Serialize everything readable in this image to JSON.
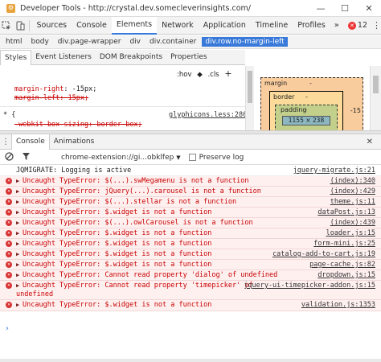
{
  "window": {
    "title": "Developer Tools - http://crystal.dev.somecleverinsights.com/",
    "minimize_glyph": "—",
    "maximize_glyph": "☐",
    "close_glyph": "✕"
  },
  "tabs": {
    "items": [
      "Sources",
      "Console",
      "Elements",
      "Network",
      "Application",
      "Timeline",
      "Profiles"
    ],
    "active": "Elements",
    "more_label": "»",
    "error_count": "12",
    "error_badge_glyph": "✕",
    "kebab_glyph": "⋮"
  },
  "breadcrumbs": [
    "html",
    "body",
    "div.page-wrapper",
    "div",
    "div.container",
    "div.row.no-margin-left"
  ],
  "styles_tabs": [
    "Styles",
    "Event Listeners",
    "DOM Breakpoints",
    "Properties"
  ],
  "styles": {
    "hov_label": ":hov",
    "cls_label": ".cls",
    "add_label": "+",
    "margin_right_prop": "margin-right",
    "margin_right_value": "-15px;",
    "margin_left_prop": "margin-left",
    "margin_left_value": "15px;",
    "rule_selector": "* {",
    "rule_source": "glyphicons.less:280",
    "box_sizing_prop": "-webkit-box-sizing",
    "box_sizing_value": "border-box;"
  },
  "box_model": {
    "margin_label": "margin",
    "margin_value": "-",
    "margin_right_value": "-15",
    "border_label": "border",
    "border_value": "-",
    "padding_label": "padding",
    "padding_value": "-",
    "content_size": "1155 × 238"
  },
  "drawer": {
    "tabs": [
      "Console",
      "Animations"
    ],
    "active": "Console",
    "close_glyph": "✕"
  },
  "console_toolbar": {
    "context_value": "chrome-extension://gi...obklfep",
    "preserve_log_label": "Preserve log"
  },
  "messages": [
    {
      "type": "info",
      "text": "JQMIGRATE: Logging is active",
      "source": "jquery-migrate.js:21"
    },
    {
      "type": "error",
      "text": "Uncaught TypeError: $(...).swMegamenu is not a function",
      "source": "(index):340"
    },
    {
      "type": "error",
      "text": "Uncaught TypeError: jQuery(...).carousel is not a function",
      "source": "(index):429"
    },
    {
      "type": "error",
      "text": "Uncaught TypeError: $(...).stellar is not a function",
      "source": "theme.js:11"
    },
    {
      "type": "error",
      "text": "Uncaught TypeError: $.widget is not a function",
      "source": "dataPost.js:13"
    },
    {
      "type": "error",
      "text": "Uncaught TypeError: $(...).owlCarousel is not a function",
      "source": "(index):439"
    },
    {
      "type": "error",
      "text": "Uncaught TypeError: $.widget is not a function",
      "source": "loader.js:15"
    },
    {
      "type": "error",
      "text": "Uncaught TypeError: $.widget is not a function",
      "source": "form-mini.js:25"
    },
    {
      "type": "error",
      "text": "Uncaught TypeError: $.widget is not a function",
      "source": "catalog-add-to-cart.js:19"
    },
    {
      "type": "error",
      "text": "Uncaught TypeError: $.widget is not a function",
      "source": "page-cache.js:82"
    },
    {
      "type": "error",
      "text": "Uncaught TypeError: Cannot read property 'dialog' of undefined",
      "source": "dropdown.js:15"
    },
    {
      "type": "error",
      "text": "Uncaught TypeError: Cannot read property 'timepicker' of",
      "text2": "undefined",
      "source": "jquery-ui-timepicker-addon.js:15"
    },
    {
      "type": "error",
      "text": "Uncaught TypeError: $.widget is not a function",
      "source": "validation.js:1353"
    }
  ],
  "prompt_glyph": "›"
}
